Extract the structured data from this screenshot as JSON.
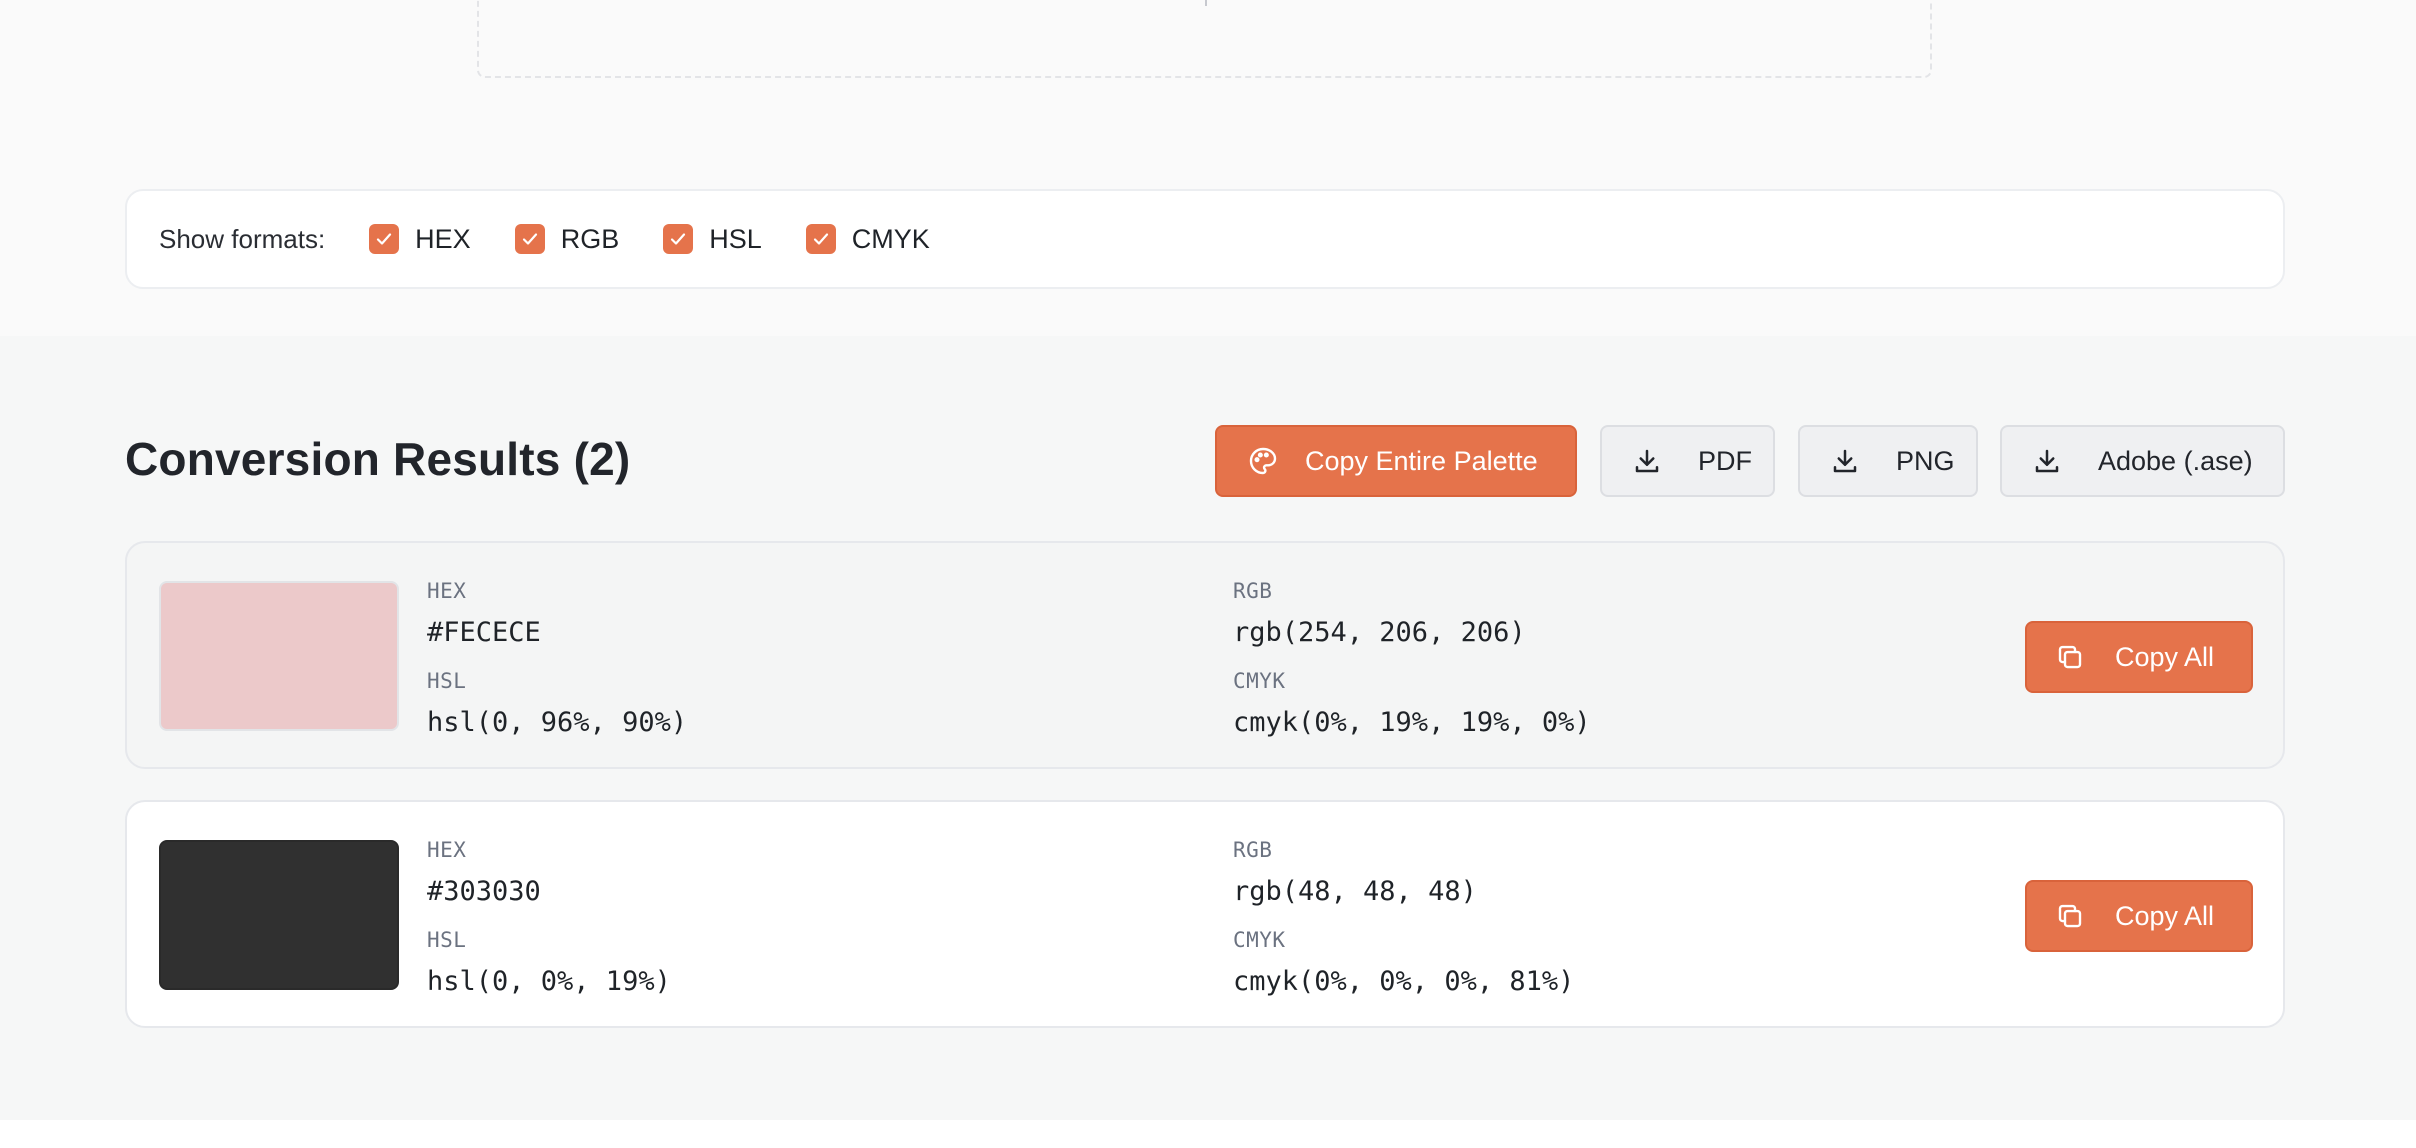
{
  "filters": {
    "label": "Show formats:",
    "options": [
      {
        "label": "HEX",
        "checked": true
      },
      {
        "label": "RGB",
        "checked": true
      },
      {
        "label": "HSL",
        "checked": true
      },
      {
        "label": "CMYK",
        "checked": true
      }
    ]
  },
  "results": {
    "title": "Conversion Results (2)",
    "actions": {
      "copy_palette": {
        "label": "Copy Entire Palette",
        "icon": "palette-icon"
      },
      "pdf": {
        "label": "PDF",
        "icon": "download-icon"
      },
      "png": {
        "label": "PNG",
        "icon": "download-icon"
      },
      "ase": {
        "label": "Adobe (.ase)",
        "icon": "download-icon"
      }
    },
    "colors": [
      {
        "swatch": "#FECECE",
        "hex_label": "HEX",
        "hex": "#FECECE",
        "rgb_label": "RGB",
        "rgb": "rgb(254, 206, 206)",
        "hsl_label": "HSL",
        "hsl": "hsl(0, 96%, 90%)",
        "cmyk_label": "CMYK",
        "cmyk": "cmyk(0%, 19%, 19%, 0%)",
        "copy_label": "Copy All"
      },
      {
        "swatch": "#303030",
        "hex_label": "HEX",
        "hex": "#303030",
        "rgb_label": "RGB",
        "rgb": "rgb(48, 48, 48)",
        "hsl_label": "HSL",
        "hsl": "hsl(0, 0%, 19%)",
        "cmyk_label": "CMYK",
        "cmyk": "cmyk(0%, 0%, 0%, 81%)",
        "copy_label": "Copy All"
      }
    ]
  },
  "theme": {
    "accent": "#E5734B",
    "page_bg": "#FAFAFA",
    "results_bg": "#F6F7F7"
  }
}
